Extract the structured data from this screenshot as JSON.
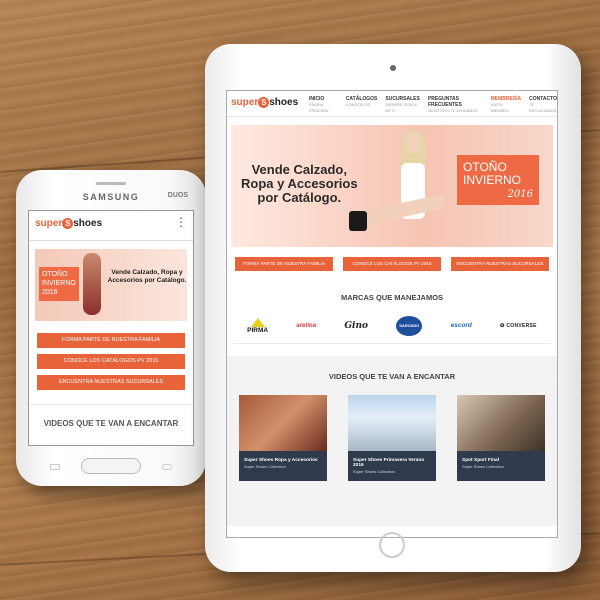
{
  "phone": {
    "brand": "SAMSUNG",
    "model": "DUOS",
    "logo": {
      "super": "super",
      "s": "S",
      "shoes": "shoes"
    },
    "menu_icon": "⋮",
    "banner": {
      "season_line1": "OTOÑO",
      "season_line2": "INVIERNO",
      "year": "2016",
      "tagline": "Vende Calzado, Ropa y Accesorios por Catálogo."
    },
    "buttons": [
      "FORMA PARTE DE NUESTRA FAMILIA",
      "CONOCE LOS CATÁLOGOS PV 2016",
      "ENCUENTRA NUESTRAS SUCURSALES"
    ],
    "videos_title": "VIDEOS QUE TE VAN A ENCANTAR"
  },
  "tablet": {
    "logo": {
      "super": "super",
      "s": "S",
      "shoes": "shoes"
    },
    "nav": [
      {
        "label": "INICIO",
        "sub": "PÁGINA PRINCIPAL"
      },
      {
        "label": "CATÁLOGOS",
        "sub": "CONÓCELOS"
      },
      {
        "label": "SUCURSALES",
        "sub": "SIEMPRE CERCA DE TI"
      },
      {
        "label": "PREGUNTAS FRECUENTES",
        "sub": "NOSOTROS TE AYUDAMOS"
      },
      {
        "label": "MEMBRESÍA",
        "sub": "HAZTE MIEMBRO"
      },
      {
        "label": "CONTACTO",
        "sub": "TE ESCUCHAMOS"
      }
    ],
    "banner": {
      "tagline_line1": "Vende Calzado,",
      "tagline_line2": "Ropa y Accesorios",
      "tagline_line3": "por Catálogo.",
      "season_line1": "OTOÑO",
      "season_line2": "INVIERNO",
      "year": "2016"
    },
    "buttons": [
      "FORMA PARTE DE NUESTRA FAMILIA",
      "CONOCE LOS CATÁLOGOS PV 2016",
      "ENCUENTRA NUESTRAS SUCURSALES"
    ],
    "brands_title": "MARCAS QUE MANEJAMOS",
    "brands": [
      "PIRMA",
      "aretina",
      "Gino",
      "SAROSSO",
      "escord",
      "CONVERSE"
    ],
    "videos_title": "VIDEOS QUE TE VAN A ENCANTAR",
    "videos": [
      {
        "title": "Super Shoes Ropa y Accesorios",
        "sub": "Super Shoes Collection"
      },
      {
        "title": "Super Shoes Primavera Verano 2016",
        "sub": "Super Shoes Collection"
      },
      {
        "title": "Spot Sport Final",
        "sub": "Super Shoes Collection"
      }
    ]
  },
  "colors": {
    "accent": "#e8633a",
    "video_card": "#2f3b4c"
  }
}
